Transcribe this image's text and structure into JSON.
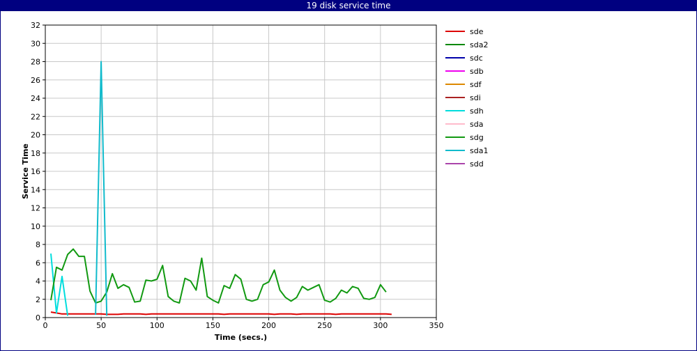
{
  "window": {
    "title": "19 disk service time"
  },
  "chart_data": {
    "type": "line",
    "title": "",
    "xlabel": "Time (secs.)",
    "ylabel": "Service Time",
    "xlim": [
      0,
      350
    ],
    "ylim": [
      0,
      32
    ],
    "xticks": [
      0,
      50,
      100,
      150,
      200,
      250,
      300,
      350
    ],
    "yticks": [
      0,
      2,
      4,
      6,
      8,
      10,
      12,
      14,
      16,
      18,
      20,
      22,
      24,
      26,
      28,
      30,
      32
    ],
    "grid": true,
    "legend": "right",
    "series": [
      {
        "name": "sde",
        "color": "#dd0000",
        "x": [
          5,
          10,
          15,
          20,
          25,
          30,
          35,
          40,
          45,
          50,
          55,
          60,
          65,
          70,
          75,
          80,
          85,
          90,
          95,
          100,
          105,
          110,
          115,
          120,
          125,
          130,
          135,
          140,
          145,
          150,
          155,
          160,
          165,
          170,
          175,
          180,
          185,
          190,
          195,
          200,
          205,
          210,
          215,
          220,
          225,
          230,
          235,
          240,
          245,
          250,
          255,
          260,
          265,
          270,
          275,
          280,
          285,
          290,
          295,
          300,
          305,
          310
        ],
        "y": [
          0.6,
          0.5,
          0.4,
          0.4,
          0.4,
          0.4,
          0.4,
          0.4,
          0.4,
          0.4,
          0.35,
          0.35,
          0.35,
          0.4,
          0.4,
          0.4,
          0.4,
          0.35,
          0.4,
          0.4,
          0.4,
          0.4,
          0.4,
          0.4,
          0.4,
          0.4,
          0.4,
          0.4,
          0.4,
          0.4,
          0.4,
          0.35,
          0.4,
          0.4,
          0.4,
          0.4,
          0.4,
          0.4,
          0.4,
          0.4,
          0.35,
          0.4,
          0.4,
          0.4,
          0.35,
          0.4,
          0.4,
          0.4,
          0.4,
          0.4,
          0.4,
          0.35,
          0.4,
          0.4,
          0.4,
          0.4,
          0.4,
          0.4,
          0.4,
          0.4,
          0.4,
          0.35
        ]
      },
      {
        "name": "sda2",
        "color": "#008800",
        "x": [],
        "y": []
      },
      {
        "name": "sdc",
        "color": "#0000aa",
        "x": [],
        "y": []
      },
      {
        "name": "sdb",
        "color": "#ee00ee",
        "x": [],
        "y": []
      },
      {
        "name": "sdf",
        "color": "#dd8800",
        "x": [],
        "y": []
      },
      {
        "name": "sdi",
        "color": "#aa2222",
        "x": [],
        "y": []
      },
      {
        "name": "sdh",
        "color": "#00dddd",
        "x": [
          5,
          10,
          15,
          20
        ],
        "y": [
          7.0,
          0.5,
          4.5,
          0.2
        ]
      },
      {
        "name": "sda",
        "color": "#ffbbcc",
        "x": [],
        "y": []
      },
      {
        "name": "sdg",
        "color": "#119911",
        "x": [
          5,
          10,
          15,
          20,
          25,
          30,
          35,
          40,
          45,
          50,
          55,
          60,
          65,
          70,
          75,
          80,
          85,
          90,
          95,
          100,
          105,
          110,
          115,
          120,
          125,
          130,
          135,
          140,
          145,
          150,
          155,
          160,
          165,
          170,
          175,
          180,
          185,
          190,
          195,
          200,
          205,
          210,
          215,
          220,
          225,
          230,
          235,
          240,
          245,
          250,
          255,
          260,
          265,
          270,
          275,
          280,
          285,
          290,
          295,
          300,
          305
        ],
        "y": [
          1.9,
          5.5,
          5.2,
          6.9,
          7.5,
          6.7,
          6.7,
          2.9,
          1.6,
          1.8,
          2.8,
          4.8,
          3.2,
          3.6,
          3.3,
          1.7,
          1.8,
          4.1,
          4.0,
          4.2,
          5.7,
          2.3,
          1.8,
          1.6,
          4.3,
          4.0,
          3.0,
          6.5,
          2.3,
          1.9,
          1.6,
          3.5,
          3.2,
          4.7,
          4.2,
          2.0,
          1.8,
          2.0,
          3.6,
          3.9,
          5.2,
          3.0,
          2.2,
          1.8,
          2.2,
          3.4,
          3.0,
          3.3,
          3.6,
          1.9,
          1.7,
          2.1,
          3.0,
          2.7,
          3.4,
          3.2,
          2.1,
          2.0,
          2.2,
          3.6,
          2.8
        ]
      },
      {
        "name": "sda1",
        "color": "#11bbcc",
        "x": [
          45,
          50,
          55
        ],
        "y": [
          0.3,
          28.0,
          0.2
        ]
      },
      {
        "name": "sdd",
        "color": "#aa44aa",
        "x": [],
        "y": []
      }
    ]
  }
}
